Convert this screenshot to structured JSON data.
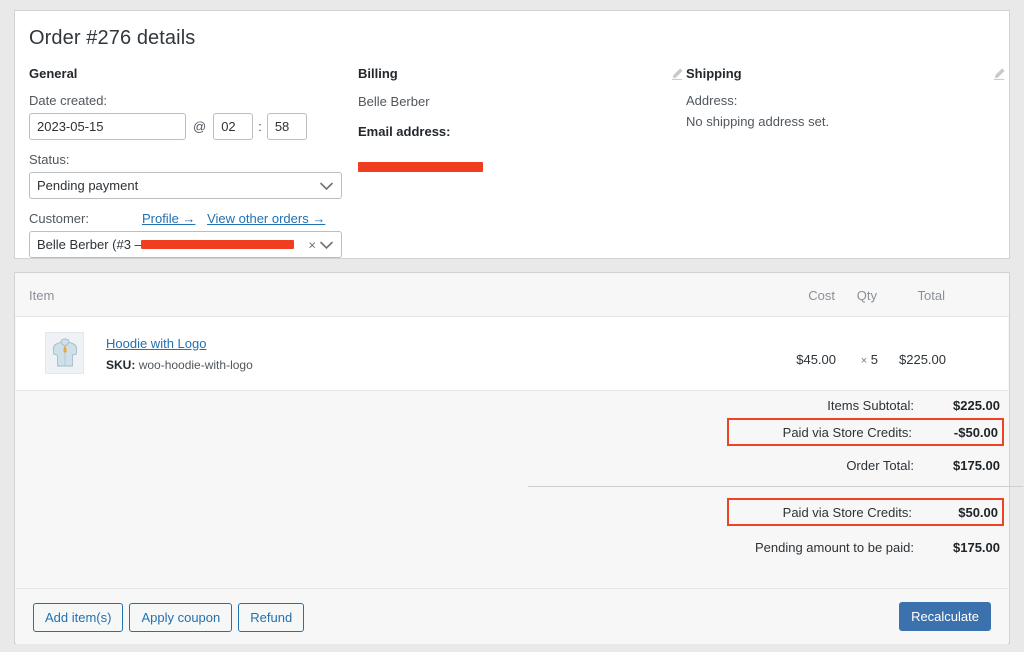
{
  "page": {
    "order_title": "Order #276 details"
  },
  "general": {
    "heading": "General",
    "date_label": "Date created:",
    "date_value": "2023-05-15",
    "at_symbol": "@",
    "hour_value": "02",
    "colon": ":",
    "minute_value": "58",
    "status_label": "Status:",
    "status_value": "Pending payment",
    "customer_label": "Customer:",
    "profile_link": "Profile →",
    "other_orders_link": "View other orders →",
    "customer_value": "Belle Berber (#3 –",
    "clear_icon": "×"
  },
  "billing": {
    "heading": "Billing",
    "edit_icon": "pencil-icon",
    "name": "Belle Berber",
    "email_label": "Email address:",
    "email_value_redacted": ""
  },
  "shipping": {
    "heading": "Shipping",
    "edit_icon": "pencil-icon",
    "address_label": "Address:",
    "address_value": "No shipping address set."
  },
  "items": {
    "columns": {
      "item": "Item",
      "cost": "Cost",
      "qty": "Qty",
      "total": "Total"
    },
    "rows": [
      {
        "name": "Hoodie with Logo",
        "sku_label": "SKU:",
        "sku_value": "woo-hoodie-with-logo",
        "cost": "$45.00",
        "qty_symbol": "×",
        "qty": "5",
        "total": "$225.00"
      }
    ]
  },
  "totals": {
    "subtotal_label": "Items Subtotal:",
    "subtotal_value": "$225.00",
    "credit_label_1": "Paid via Store Credits:",
    "credit_value_1": "-$50.00",
    "order_total_label": "Order Total:",
    "order_total_value": "$175.00",
    "credit_label_2": "Paid via Store Credits:",
    "credit_value_2": "$50.00",
    "pending_label": "Pending amount to be paid:",
    "pending_value": "$175.00"
  },
  "footer": {
    "add_items": "Add item(s)",
    "apply_coupon": "Apply coupon",
    "refund": "Refund",
    "recalculate": "Recalculate"
  },
  "colors": {
    "highlight": "#ef4423",
    "link": "#2271b1",
    "primary_button": "#3b72ad",
    "redaction": "#ef3d20"
  }
}
